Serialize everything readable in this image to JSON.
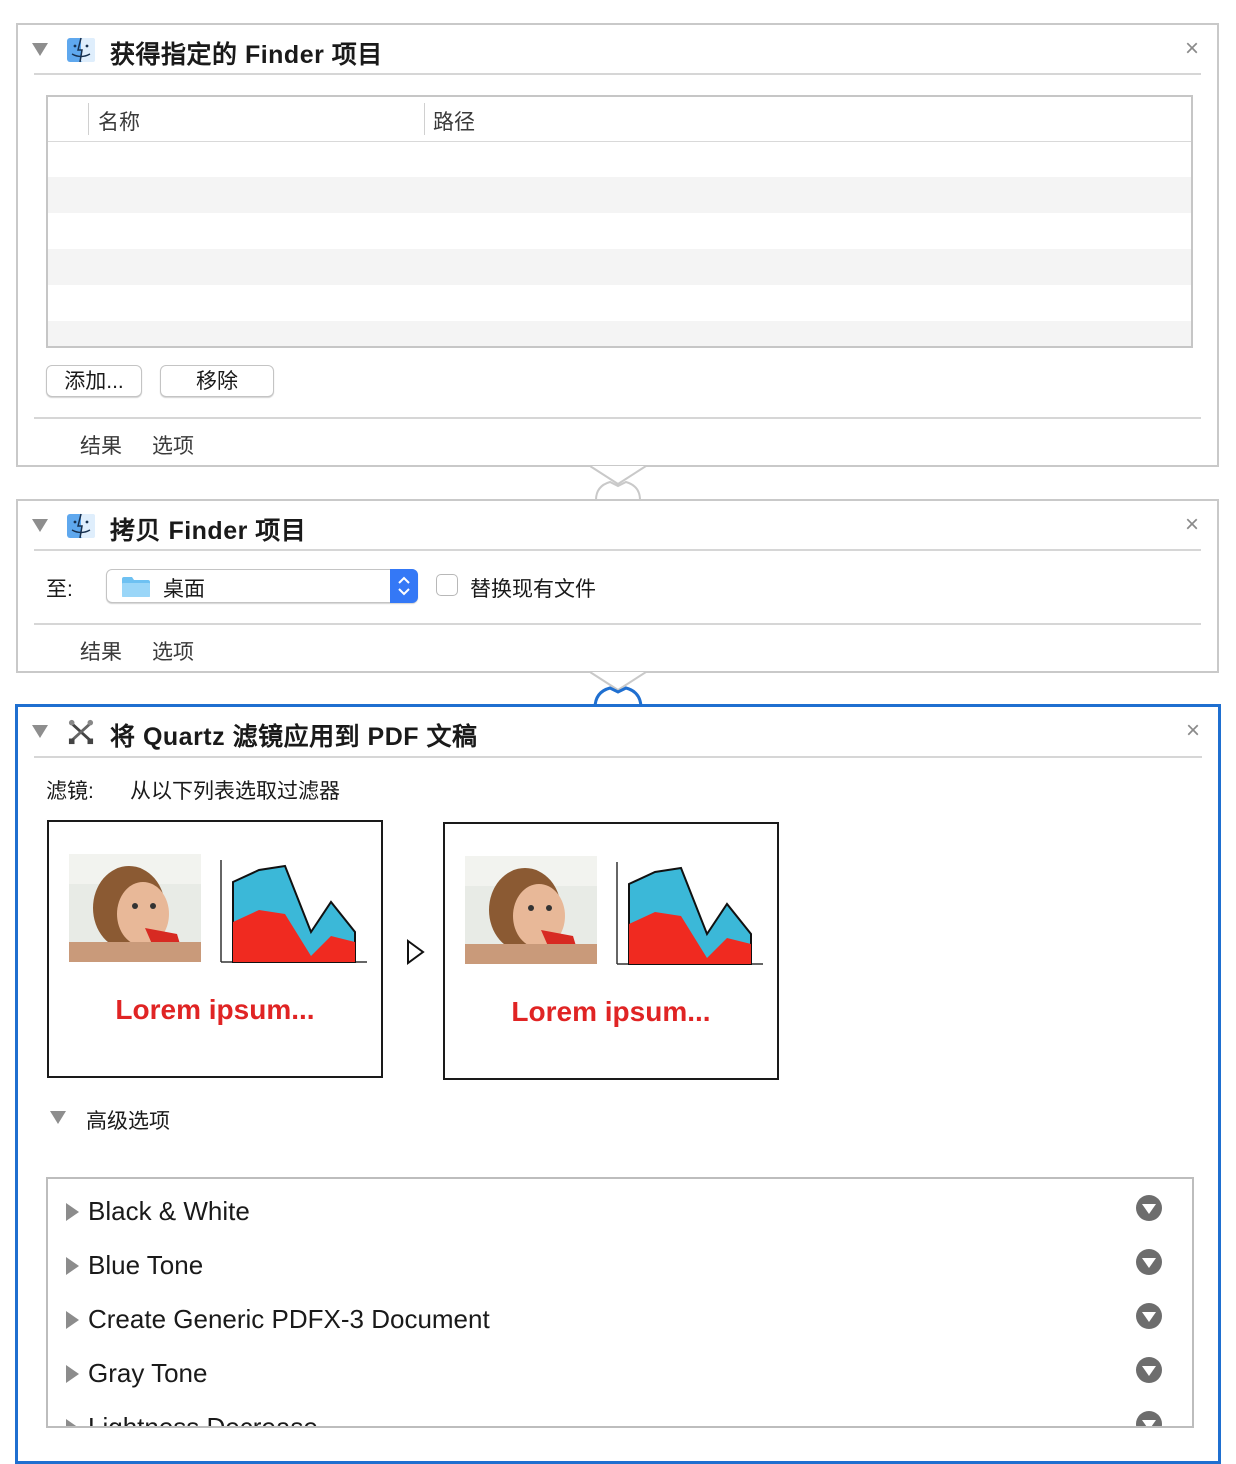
{
  "panel1": {
    "title": "获得指定的 Finder 项目",
    "columns": {
      "name": "名称",
      "path": "路径"
    },
    "add_button": "添加...",
    "remove_button": "移除",
    "tabs": {
      "results": "结果",
      "options": "选项"
    },
    "close_glyph": "×"
  },
  "panel2": {
    "title": "拷贝 Finder 项目",
    "to_label": "至:",
    "destination": "桌面",
    "replace_label": "替换现有文件",
    "tabs": {
      "results": "结果",
      "options": "选项"
    },
    "close_glyph": "×"
  },
  "panel3": {
    "title": "将 Quartz 滤镜应用到 PDF 文稿",
    "filter_label": "滤镜:",
    "filter_hint": "从以下列表选取过滤器",
    "preview_caption": "Lorem ipsum...",
    "advanced_label": "高级选项",
    "close_glyph": "×",
    "filters": [
      "Black & White",
      "Blue Tone",
      "Create Generic PDFX-3 Document",
      "Gray Tone",
      "Lightness Decrease"
    ]
  },
  "colors": {
    "accent": "#1f6fd0",
    "lorem_red": "#e02424",
    "chart_blue": "#3bb8d8",
    "chart_red": "#f02a20"
  }
}
